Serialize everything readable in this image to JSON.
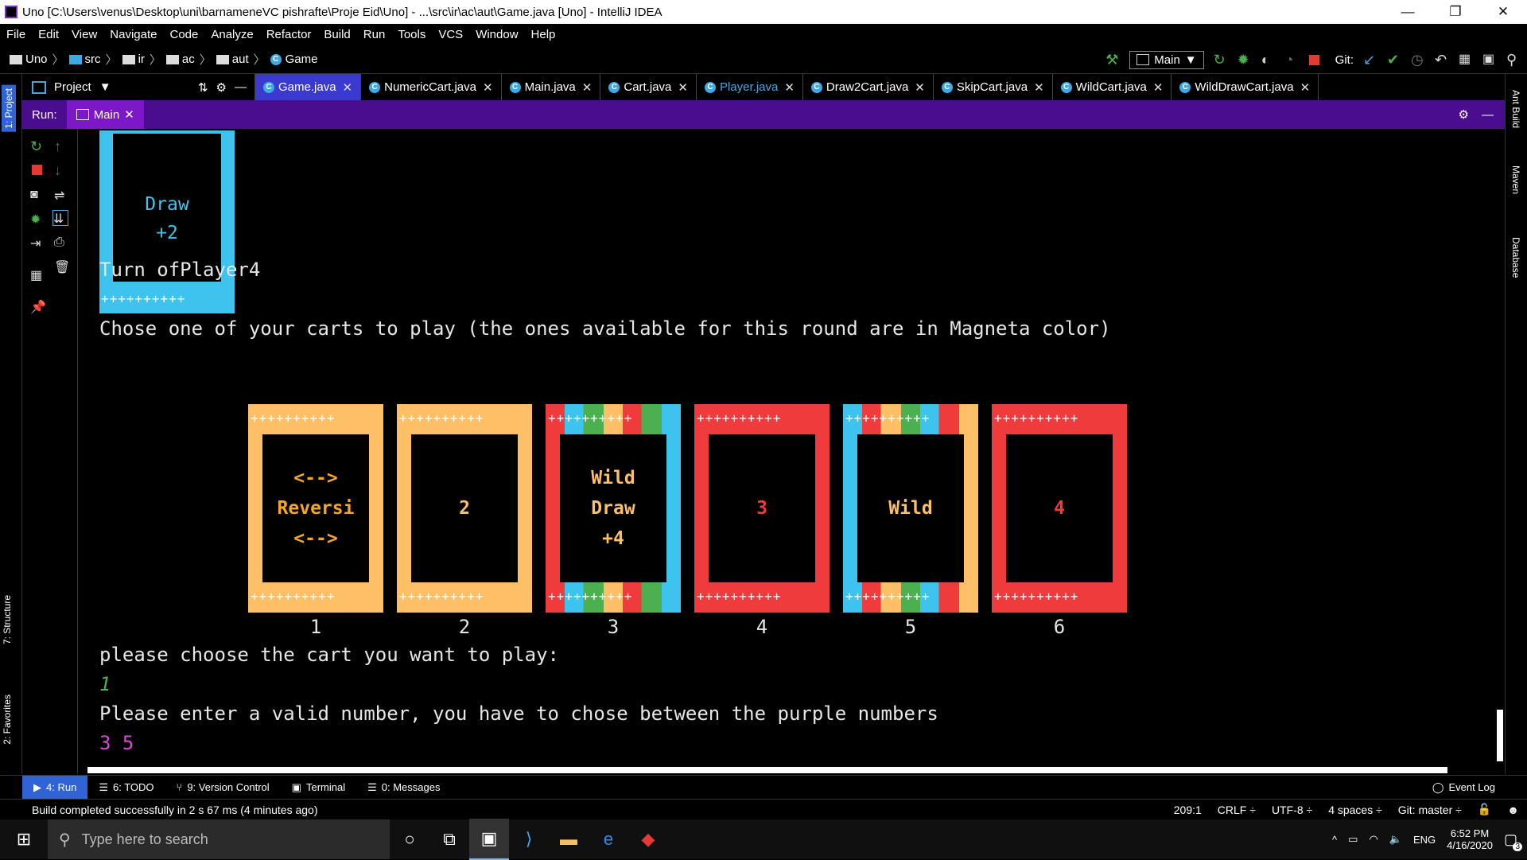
{
  "window": {
    "title": "Uno [C:\\Users\\venus\\Desktop\\uni\\barnameneVC pishrafte\\Proje Eid\\Uno] - ...\\src\\ir\\ac\\aut\\Game.java [Uno] - IntelliJ IDEA",
    "minimize": "—",
    "restore": "❐",
    "close": "✕"
  },
  "menu": [
    "File",
    "Edit",
    "View",
    "Navigate",
    "Code",
    "Analyze",
    "Refactor",
    "Build",
    "Run",
    "Tools",
    "VCS",
    "Window",
    "Help"
  ],
  "breadcrumbs": [
    "Uno",
    "src",
    "ir",
    "ac",
    "aut",
    "Game"
  ],
  "toolbar": {
    "run_config": "Main",
    "git_label": "Git:"
  },
  "project_panel": {
    "label": "Project"
  },
  "editor_tabs": [
    {
      "label": "Game.java",
      "active": true
    },
    {
      "label": "NumericCart.java"
    },
    {
      "label": "Main.java"
    },
    {
      "label": "Cart.java"
    },
    {
      "label": "Player.java"
    },
    {
      "label": "Draw2Cart.java"
    },
    {
      "label": "SkipCart.java"
    },
    {
      "label": "WildCart.java"
    },
    {
      "label": "WildDrawCart.java"
    }
  ],
  "left_vertical_tabs": [
    "1: Project",
    "7: Structure",
    "2: Favorites"
  ],
  "right_vertical_tabs": [
    "Ant Build",
    "Maven",
    "Database"
  ],
  "run": {
    "label": "Run:",
    "tab": "Main"
  },
  "console": {
    "top_card": {
      "line1": "Draw",
      "line2": "+2",
      "color": "#3ec3ee"
    },
    "turn": "Turn ofPlayer4",
    "prompt": "Chose one of your carts to play (the ones available for this round are in Magneta color)",
    "cards": [
      {
        "lines": [
          "<-->",
          "Reversi",
          "<-->"
        ],
        "color": "#ffbf66",
        "text_color": "#f5a623",
        "index": "1"
      },
      {
        "lines": [
          "2"
        ],
        "color": "#ffbf66",
        "text_color": "#ffbf66",
        "index": "2"
      },
      {
        "lines": [
          "Wild",
          "Draw",
          "+4"
        ],
        "color": "multi",
        "text_color": "#ffbf66",
        "index": "3"
      },
      {
        "lines": [
          "3"
        ],
        "color": "#ef3b3b",
        "text_color": "#ef3b3b",
        "index": "4"
      },
      {
        "lines": [
          "Wild"
        ],
        "color": "multi",
        "text_color": "#ffbf66",
        "index": "5"
      },
      {
        "lines": [
          "4"
        ],
        "color": "#ef3b3b",
        "text_color": "#ef3b3b",
        "index": "6"
      }
    ],
    "choose": "please choose the cart you want to play:",
    "user_input": "1",
    "error": "Please enter a valid number, you have to chose between the purple numbers",
    "valid_numbers": "3 5"
  },
  "tool_tabs": [
    {
      "label": "4: Run",
      "active": true
    },
    {
      "label": "6: TODO"
    },
    {
      "label": "9: Version Control"
    },
    {
      "label": "Terminal"
    },
    {
      "label": "0: Messages"
    }
  ],
  "event_log": "Event Log",
  "status": {
    "message": "Build completed successfully in 2 s 67 ms (4 minutes ago)",
    "position": "209:1",
    "line_sep": "CRLF ÷",
    "encoding": "UTF-8 ÷",
    "indent": "4 spaces ÷",
    "git": "Git: master ÷"
  },
  "taskbar": {
    "search_placeholder": "Type here to search",
    "lang": "ENG",
    "time": "6:52 PM",
    "date": "4/16/2020",
    "notifications": "3"
  },
  "colors": {
    "accent_blue": "#3ec3ee",
    "orange": "#ffbf66",
    "red": "#ef3b3b",
    "green": "#4caf50",
    "purple_run": "#4b0d8f",
    "magenta": "#d24bd2"
  }
}
